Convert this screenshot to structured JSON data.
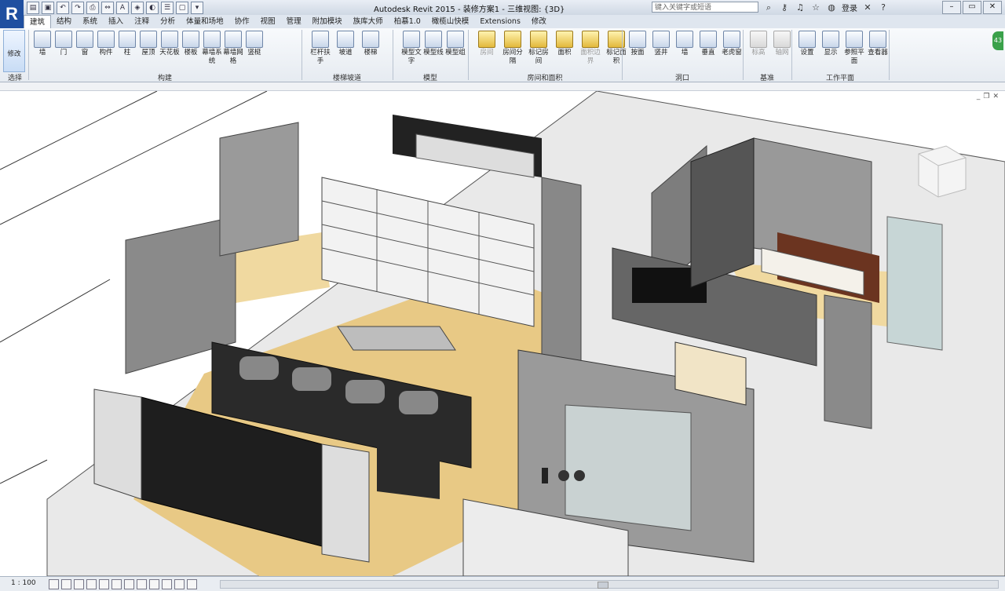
{
  "app": {
    "logo": "R",
    "title": "Autodesk Revit 2015 -   装修方案1 - 三维视图: {3D}",
    "search_placeholder": "键入关键字或短语",
    "login": "登录",
    "badge": "43"
  },
  "tabs": [
    "建筑",
    "结构",
    "系统",
    "插入",
    "注释",
    "分析",
    "体量和场地",
    "协作",
    "视图",
    "管理",
    "附加模块",
    "族库大师",
    "柏慕1.0",
    "橄榄山快模",
    "Extensions",
    "修改"
  ],
  "ribbon": {
    "select": {
      "modify": "修改",
      "select_label": "选择"
    },
    "build": [
      "墙",
      "门",
      "窗",
      "构件",
      "柱",
      "屋顶",
      "天花板",
      "楼板",
      "幕墙系统",
      "幕墙网格",
      "竖梃"
    ],
    "stairs": [
      "栏杆扶手",
      "坡道",
      "楼梯"
    ],
    "model": [
      "模型文字",
      "模型线",
      "模型组"
    ],
    "rooms": [
      "房间",
      "房间分隔",
      "标记房间",
      "面积",
      "面积边界",
      "标记面积"
    ],
    "opening": [
      "按面",
      "竖井",
      "墙",
      "垂直",
      "老虎窗"
    ],
    "datum": [
      "标高",
      "轴网"
    ],
    "workplane": [
      "设置",
      "显示",
      "参照平面",
      "查看器"
    ]
  },
  "panels": [
    "选择",
    "构建",
    "楼梯坡道",
    "模型",
    "房间和面积",
    "洞口",
    "基准",
    "工作平面"
  ],
  "status": {
    "scale": "1 : 100"
  }
}
